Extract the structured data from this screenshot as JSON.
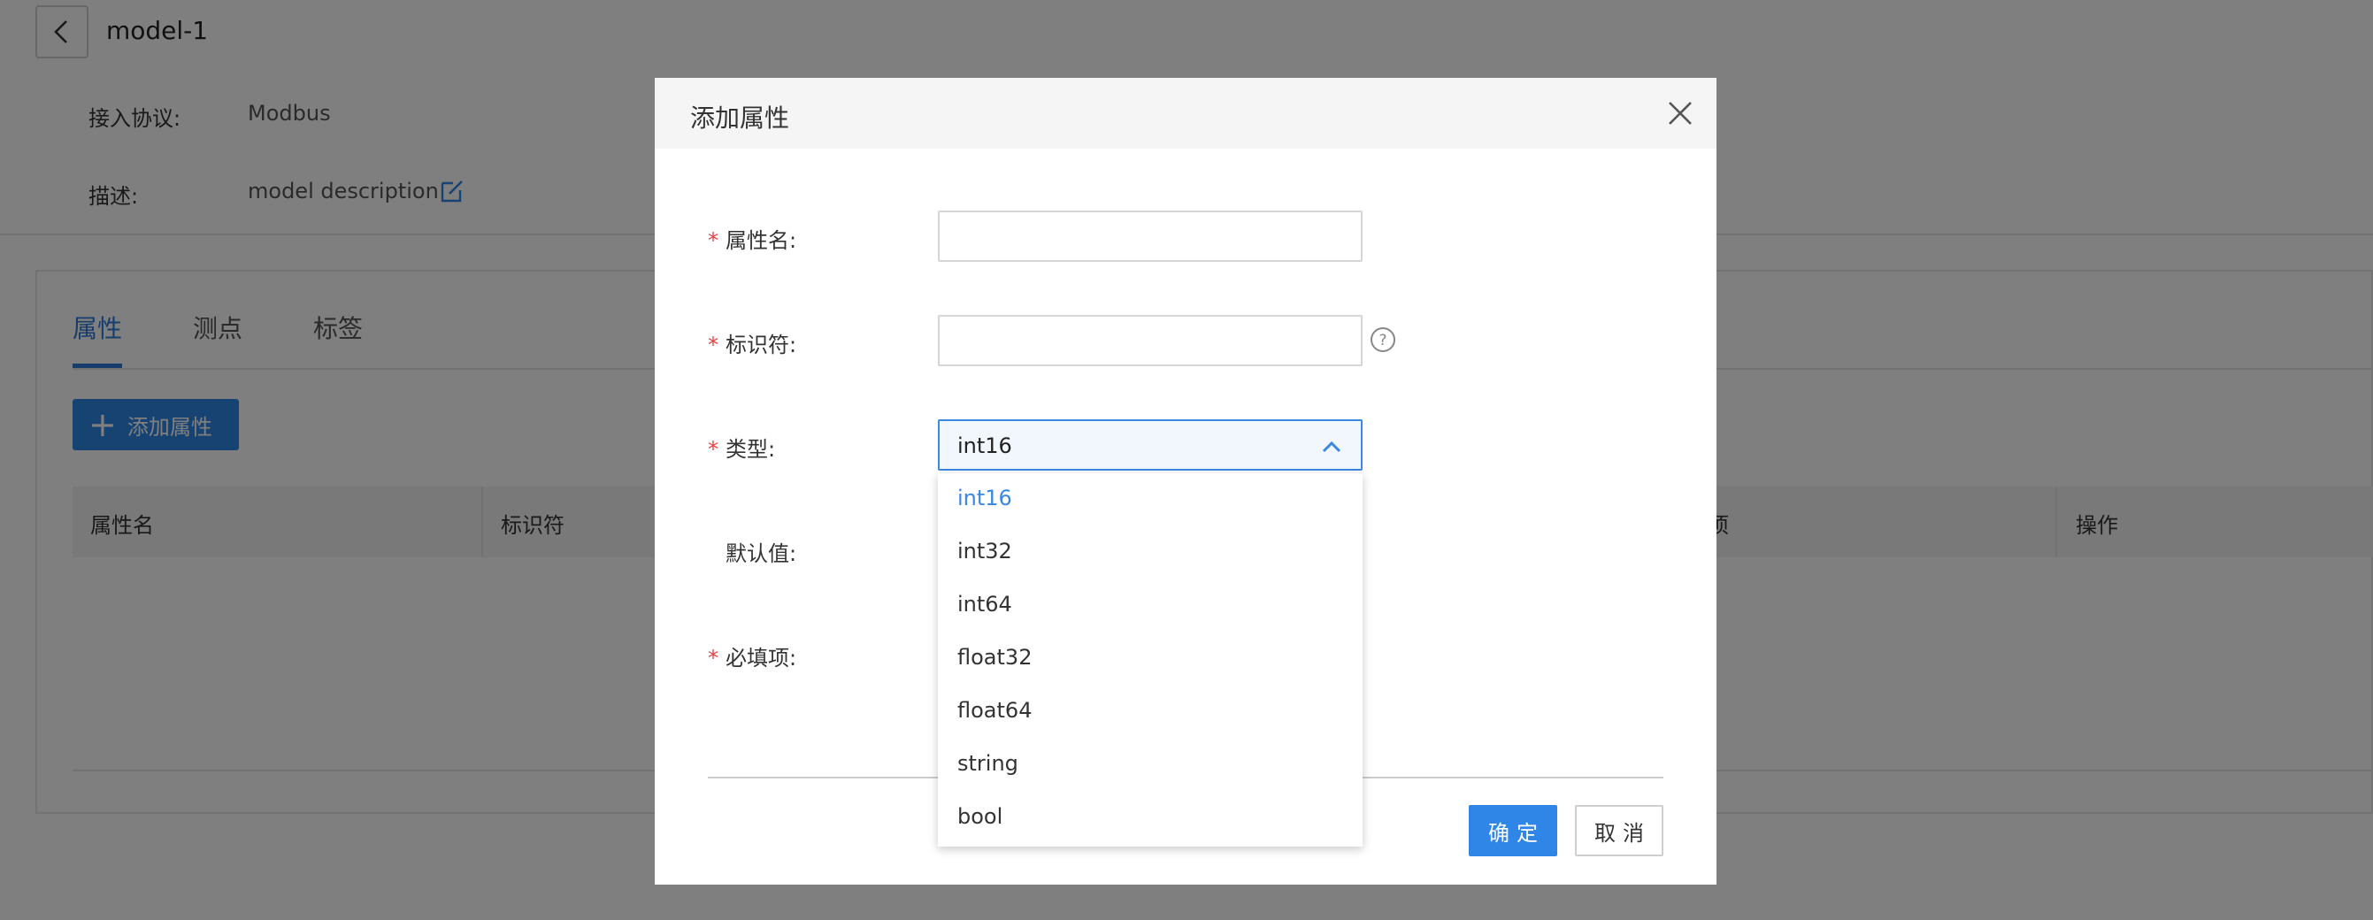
{
  "page": {
    "title": "model-1",
    "protocol_label": "接入协议:",
    "protocol_value": "Modbus",
    "description_label": "描述:",
    "description_value": "model description",
    "tabs": [
      {
        "label": "属性",
        "active": true
      },
      {
        "label": "测点",
        "active": false
      },
      {
        "label": "标签",
        "active": false
      }
    ],
    "add_button_label": "添加属性",
    "table_headers": [
      "属性名",
      "标识符",
      "项",
      "操作"
    ]
  },
  "modal": {
    "title": "添加属性",
    "fields": {
      "name_label": "属性名:",
      "identifier_label": "标识符:",
      "type_label": "类型:",
      "default_label": "默认值:",
      "required_label": "必填项:"
    },
    "required_mark": "*",
    "name_value": "",
    "identifier_value": "",
    "type_selected": "int16",
    "type_options": [
      "int16",
      "int32",
      "int64",
      "float32",
      "float64",
      "string",
      "bool"
    ],
    "ok_label": "确定",
    "cancel_label": "取消"
  },
  "colors": {
    "accent": "#2f86e6",
    "required": "#e64340",
    "overlay": "rgba(0,0,0,0.5)"
  }
}
